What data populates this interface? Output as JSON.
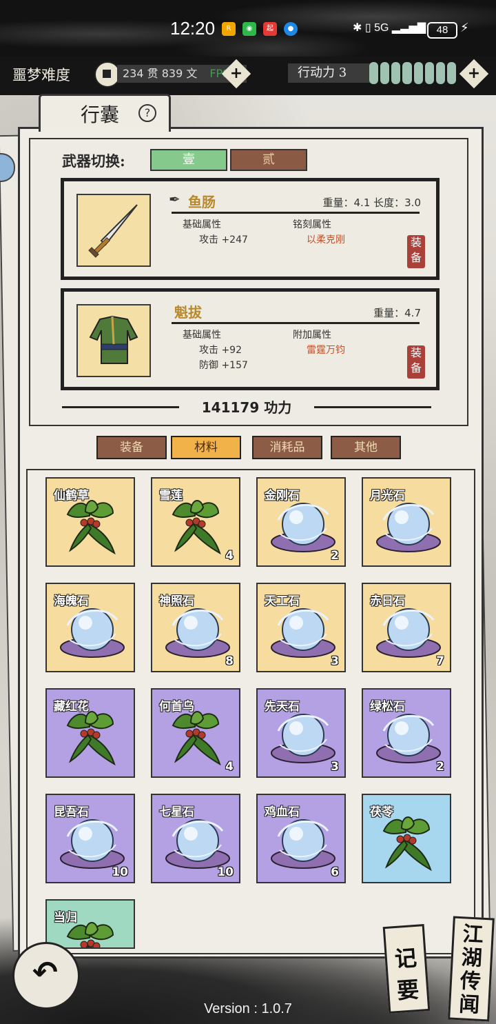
{
  "status": {
    "time": "12:20",
    "network": "5G",
    "battery": "48"
  },
  "topbar": {
    "difficulty": "噩梦难度",
    "money": "234 贯  839 文",
    "fps": "FPS",
    "action_label": "行动力 3",
    "energy_segments": 8
  },
  "panel": {
    "title": "行囊",
    "weapon_switch_label": "武器切换:",
    "weapon_tabs": [
      "壹",
      "贰"
    ],
    "active_weapon_tab": 0
  },
  "weapon": {
    "name": "鱼肠",
    "meta": "重量：4.1  长度：3.0",
    "base_label": "基础属性",
    "base_values": [
      "攻击 +247"
    ],
    "extra_label": "铭刻属性",
    "extra_values": [
      "以柔克刚"
    ],
    "stamp": "装备",
    "icon": "sword-icon"
  },
  "armor": {
    "name": "魁拔",
    "meta": "重量：4.7",
    "base_label": "基础属性",
    "base_values": [
      "攻击 +92",
      "防御 +157"
    ],
    "extra_label": "附加属性",
    "extra_values": [
      "雷霆万钧"
    ],
    "stamp": "装备",
    "icon": "robe-icon"
  },
  "power": "141179 功力",
  "categories": [
    "装备",
    "材料",
    "消耗品",
    "其他"
  ],
  "active_category": 1,
  "items": [
    {
      "name": "仙鹤草",
      "qty": "",
      "kind": "herb",
      "rarity": "y"
    },
    {
      "name": "雪莲",
      "qty": "4",
      "kind": "herb",
      "rarity": "y"
    },
    {
      "name": "金刚石",
      "qty": "2",
      "kind": "orb",
      "rarity": "y"
    },
    {
      "name": "月光石",
      "qty": "",
      "kind": "orb",
      "rarity": "y"
    },
    {
      "name": "海魄石",
      "qty": "",
      "kind": "orb",
      "rarity": "y"
    },
    {
      "name": "神照石",
      "qty": "8",
      "kind": "orb",
      "rarity": "y"
    },
    {
      "name": "天工石",
      "qty": "3",
      "kind": "orb",
      "rarity": "y"
    },
    {
      "name": "赤日石",
      "qty": "7",
      "kind": "orb",
      "rarity": "y"
    },
    {
      "name": "藏红花",
      "qty": "",
      "kind": "herb",
      "rarity": "p"
    },
    {
      "name": "何首乌",
      "qty": "4",
      "kind": "herb",
      "rarity": "p"
    },
    {
      "name": "先天石",
      "qty": "3",
      "kind": "orb",
      "rarity": "p"
    },
    {
      "name": "绿松石",
      "qty": "2",
      "kind": "orb",
      "rarity": "p"
    },
    {
      "name": "昆吾石",
      "qty": "10",
      "kind": "orb",
      "rarity": "p"
    },
    {
      "name": "七星石",
      "qty": "10",
      "kind": "orb",
      "rarity": "p"
    },
    {
      "name": "鸡血石",
      "qty": "6",
      "kind": "orb",
      "rarity": "p"
    },
    {
      "name": "茯苓",
      "qty": "",
      "kind": "herb",
      "rarity": "b"
    },
    {
      "name": "当归",
      "qty": "",
      "kind": "herb",
      "rarity": "g"
    }
  ],
  "bottom": {
    "notes": "记要",
    "rumors": "江湖传闻",
    "version": "Version : 1.0.7"
  },
  "colors": {
    "rarity_yellow": "#f6dd9f",
    "rarity_purple": "#b3a1e4",
    "rarity_blue": "#a7d6ef",
    "rarity_green": "#9fd9c2",
    "active_tab": "#86c98c",
    "active_category": "#f2b24a"
  }
}
